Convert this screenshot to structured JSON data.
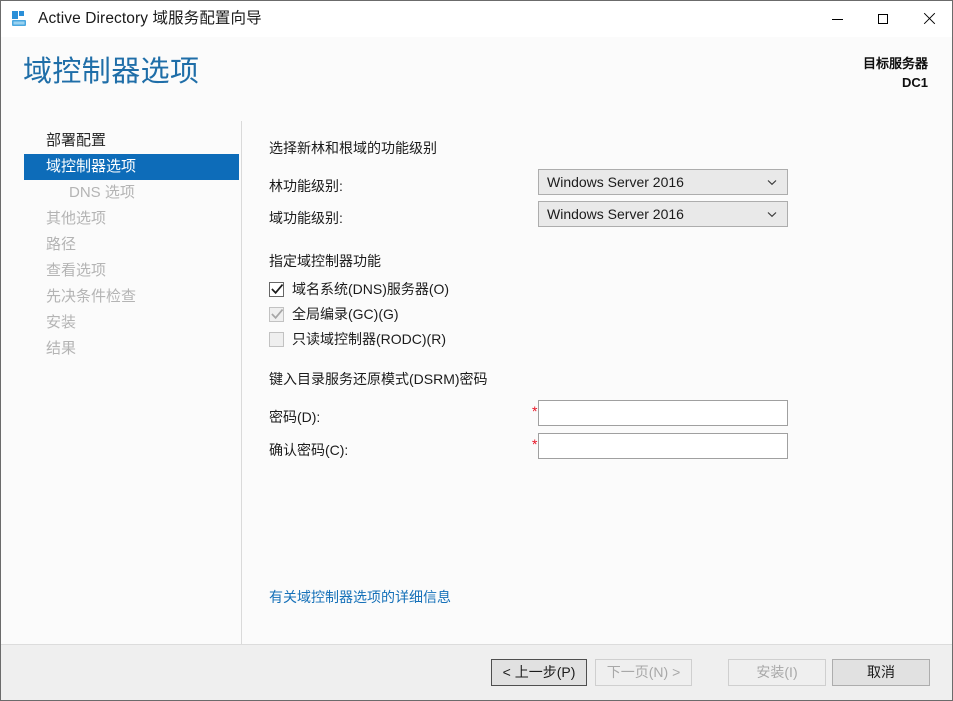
{
  "titlebar": {
    "icon": "ad-server-icon",
    "title": "Active Directory 域服务配置向导",
    "minimize_label": "最小化",
    "maximize_label": "最大化",
    "close_label": "关闭"
  },
  "header": {
    "page_title": "域控制器选项",
    "target_server_caption": "目标服务器",
    "target_server_name": "DC1"
  },
  "sidebar": {
    "items": [
      {
        "label": "部署配置",
        "state": "completed",
        "indent": false
      },
      {
        "label": "域控制器选项",
        "state": "active",
        "indent": false
      },
      {
        "label": "DNS 选项",
        "state": "disabled",
        "indent": true
      },
      {
        "label": "其他选项",
        "state": "disabled",
        "indent": false
      },
      {
        "label": "路径",
        "state": "disabled",
        "indent": false
      },
      {
        "label": "查看选项",
        "state": "disabled",
        "indent": false
      },
      {
        "label": "先决条件检查",
        "state": "disabled",
        "indent": false
      },
      {
        "label": "安装",
        "state": "disabled",
        "indent": false
      },
      {
        "label": "结果",
        "state": "disabled",
        "indent": false
      }
    ]
  },
  "content": {
    "functional_level_heading": "选择新林和根域的功能级别",
    "forest_level_label": "林功能级别:",
    "forest_level_value": "Windows Server 2016",
    "domain_level_label": "域功能级别:",
    "domain_level_value": "Windows Server 2016",
    "capabilities_heading": "指定域控制器功能",
    "capabilities": [
      {
        "label": "域名系统(DNS)服务器(O)",
        "checked": true,
        "disabled": false
      },
      {
        "label": "全局编录(GC)(G)",
        "checked": true,
        "disabled": true
      },
      {
        "label": "只读域控制器(RODC)(R)",
        "checked": false,
        "disabled": true
      }
    ],
    "dsrm_heading": "键入目录服务还原模式(DSRM)密码",
    "password_label": "密码(D):",
    "password_value": "",
    "password_required_marker": "*",
    "confirm_password_label": "确认密码(C):",
    "confirm_password_value": "",
    "confirm_required_marker": "*",
    "more_info_link": "有关域控制器选项的详细信息"
  },
  "footer": {
    "back_label": "< 上一步(P)",
    "next_label": "下一页(N) >",
    "install_label": "安装(I)",
    "cancel_label": "取消"
  },
  "colors": {
    "accent_blue": "#0d6cb9",
    "title_blue": "#1f6ea8",
    "link_blue": "#1570b8",
    "required_red": "#e81123",
    "window_bg": "#fbfbfb",
    "footer_bg": "#efefef"
  }
}
